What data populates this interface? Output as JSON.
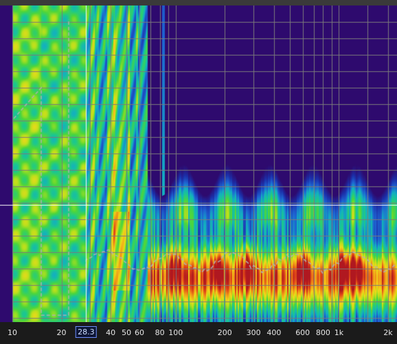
{
  "view": {
    "x_axis": {
      "scale": "log",
      "range": [
        10,
        2500
      ],
      "unit": "Hz",
      "tick_labels": [
        {
          "label": "10",
          "value": 10
        },
        {
          "label": "20",
          "value": 20
        },
        {
          "label": "40",
          "value": 40
        },
        {
          "label": "50",
          "value": 50
        },
        {
          "label": "60",
          "value": 60
        },
        {
          "label": "80",
          "value": 80
        },
        {
          "label": "100",
          "value": 100
        },
        {
          "label": "200",
          "value": 200
        },
        {
          "label": "300",
          "value": 300
        },
        {
          "label": "400",
          "value": 400
        },
        {
          "label": "600",
          "value": 600
        },
        {
          "label": "800",
          "value": 800
        },
        {
          "label": "1k",
          "value": 1000
        },
        {
          "label": "2k",
          "value": 2000
        }
      ],
      "minor_grid": [
        30,
        70,
        90,
        500,
        700,
        900,
        1500
      ]
    },
    "cursor": {
      "readout": "28.3",
      "value": 28.3
    },
    "horizontal_marker": {
      "position_fraction": 0.63
    },
    "colors": {
      "background": "#2e0a6e",
      "grid": "#7a7a7a",
      "axis_bar": "#1b1b1b",
      "overlay_trace": "#b0b0b0",
      "cursor_line": "#ffffff",
      "palette": [
        "#2e0a6e",
        "#1c2ea8",
        "#1e64d2",
        "#13b0c0",
        "#1ec98a",
        "#4ed63a",
        "#b8e01c",
        "#f0d81a",
        "#f09a18",
        "#e04418",
        "#b01820"
      ]
    }
  }
}
